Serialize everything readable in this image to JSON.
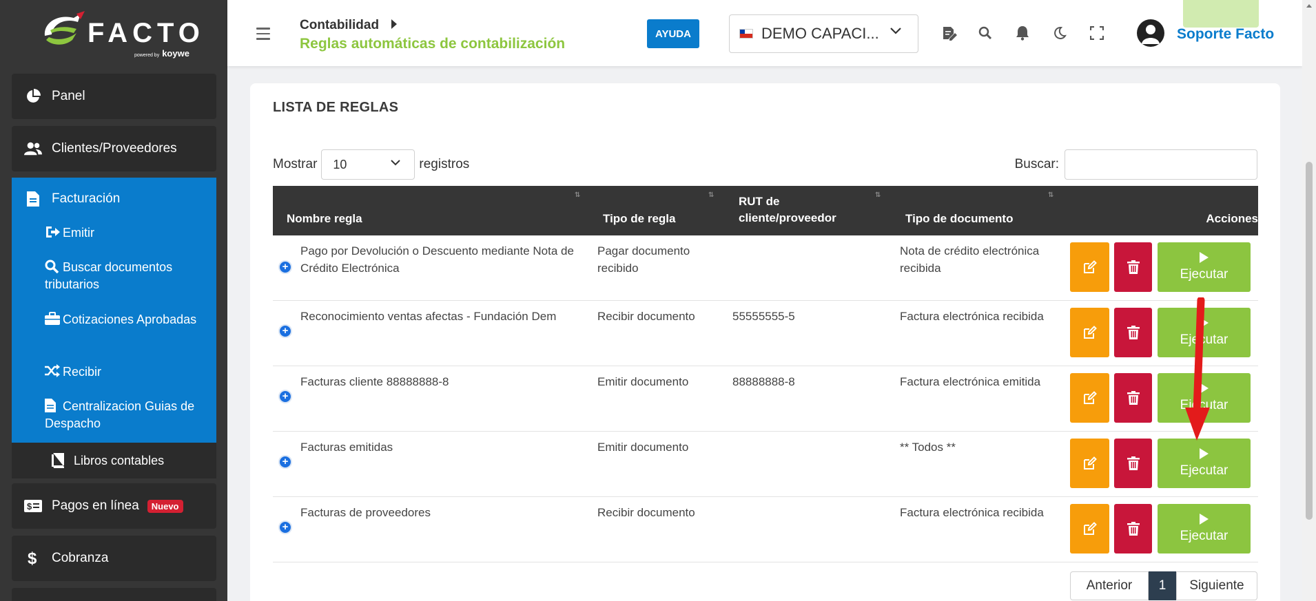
{
  "app": {
    "logo_text": "FACTO",
    "logo_powered": "powered by",
    "logo_brand": "koywe"
  },
  "sidebar": {
    "panel": "Panel",
    "clientes": "Clientes/Proveedores",
    "facturacion": "Facturación",
    "sub_items": {
      "emitir": "Emitir",
      "buscar": "Buscar documentos tributarios",
      "cotizaciones": "Cotizaciones Aprobadas",
      "recibir": "Recibir",
      "centralizacion": "Centralizacion Guias de Despacho"
    },
    "libros": "Libros contables",
    "pagos": "Pagos en línea",
    "pagos_badge": "Nuevo",
    "cobranza": "Cobranza"
  },
  "header": {
    "breadcrumb_parent": "Contabilidad",
    "page_title": "Reglas automáticas de contabilización",
    "help_label": "AYUDA",
    "company": "DEMO CAPACI...",
    "user": "Soporte Facto"
  },
  "card": {
    "title": "LISTA DE REGLAS",
    "show_prefix": "Mostrar",
    "show_value": "10",
    "show_suffix": "registros",
    "search_label": "Buscar:",
    "search_value": ""
  },
  "table": {
    "columns": {
      "nombre": "Nombre regla",
      "tipo": "Tipo de regla",
      "rut": "RUT de cliente/proveedor",
      "documento": "Tipo de documento",
      "acciones": "Acciones"
    },
    "execute_label": "Ejecutar",
    "rows": [
      {
        "nombre": "Pago por Devolución o Descuento mediante Nota de Crédito Electrónica",
        "tipo": "Pagar documento recibido",
        "rut": "",
        "documento": "Nota de crédito electrónica recibida"
      },
      {
        "nombre": "Reconocimiento ventas afectas - Fundación Dem",
        "tipo": "Recibir documento",
        "rut": "55555555-5",
        "documento": "Factura electrónica recibida"
      },
      {
        "nombre": "Facturas cliente 88888888-8",
        "tipo": "Emitir documento",
        "rut": "88888888-8",
        "documento": "Factura electrónica emitida"
      },
      {
        "nombre": "Facturas emitidas",
        "tipo": "Emitir documento",
        "rut": "",
        "documento": "** Todos **"
      },
      {
        "nombre": "Facturas de proveedores",
        "tipo": "Recibir documento",
        "rut": "",
        "documento": "Factura electrónica recibida"
      }
    ]
  },
  "pagination": {
    "prev": "Anterior",
    "current": "1",
    "next": "Siguiente"
  },
  "colors": {
    "sidebar_bg": "#363636",
    "active_blue": "#0a7ccc",
    "accent_green": "#8cc540",
    "edit_orange": "#f79d0b",
    "delete_red": "#c8163a",
    "annotation_red": "#e31b1b"
  }
}
